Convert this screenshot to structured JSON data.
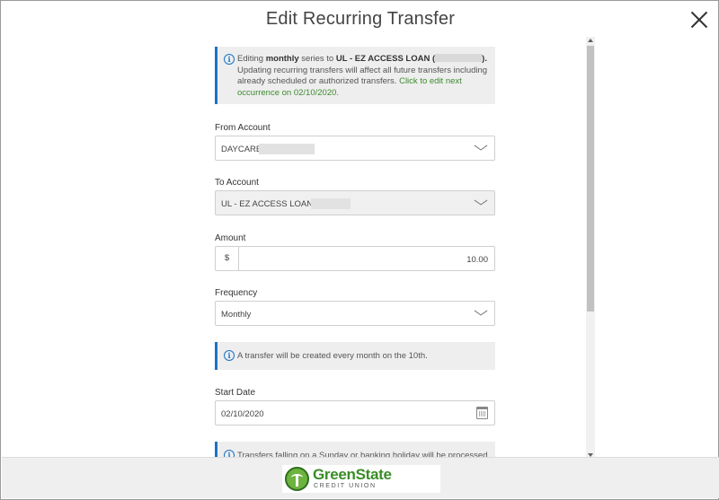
{
  "dialog": {
    "title": "Edit Recurring Transfer"
  },
  "notice": {
    "prefix": "Editing ",
    "frequency": "monthly",
    "middle": " series to ",
    "target": "UL - EZ ACCESS LOAN",
    "target_open": " (",
    "target_close": ").",
    "body": " Updating recurring transfers will affect all future transfers including already scheduled or authorized transfers. ",
    "link": "Click to edit next occurrence on 02/10/2020."
  },
  "form": {
    "from_account": {
      "label": "From Account",
      "value": "DAYCARE"
    },
    "to_account": {
      "label": "To Account",
      "value": "UL - EZ ACCESS LOAN"
    },
    "amount": {
      "label": "Amount",
      "prefix": "$",
      "value": "10.00"
    },
    "frequency": {
      "label": "Frequency",
      "value": "Monthly"
    },
    "frequency_note": "A transfer will be created every month on the 10th.",
    "start_date": {
      "label": "Start Date",
      "value": "02/10/2020"
    },
    "holiday_note": "Transfers falling on a Sunday or banking holiday will be processed"
  },
  "footer": {
    "logo_name": "GreenState",
    "logo_sub": "CREDIT UNION"
  },
  "colors": {
    "accent": "#1a73c7",
    "link": "#3d8a2e",
    "brand": "#3a8c26"
  },
  "icons": [
    "close-icon",
    "info-icon",
    "chevron-down-icon",
    "calendar-icon"
  ]
}
